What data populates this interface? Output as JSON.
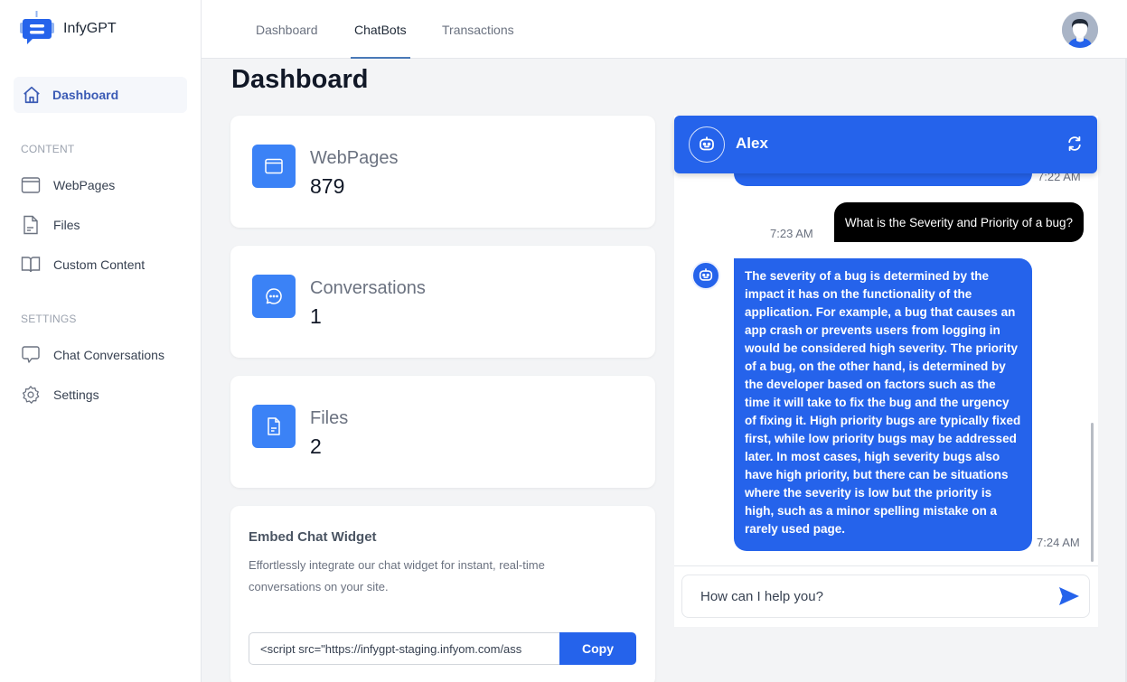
{
  "app": {
    "name": "InfyGPT"
  },
  "sidebar": {
    "active_item": {
      "label": "Dashboard",
      "icon": "home-icon"
    },
    "sections": [
      {
        "title": "CONTENT",
        "items": [
          {
            "label": "WebPages",
            "icon": "browser-window-icon"
          },
          {
            "label": "Files",
            "icon": "file-icon"
          },
          {
            "label": "Custom Content",
            "icon": "book-open-icon"
          }
        ]
      },
      {
        "title": "SETTINGS",
        "items": [
          {
            "label": "Chat Conversations",
            "icon": "chat-bubble-icon"
          },
          {
            "label": "Settings",
            "icon": "gear-icon"
          }
        ]
      }
    ]
  },
  "topbar": {
    "tabs": [
      {
        "label": "Dashboard",
        "active": false
      },
      {
        "label": "ChatBots",
        "active": true
      },
      {
        "label": "Transactions",
        "active": false
      }
    ],
    "avatar": "user-avatar"
  },
  "page": {
    "title": "Dashboard"
  },
  "stats": [
    {
      "label": "WebPages",
      "value": "879",
      "icon": "browser-window-icon"
    },
    {
      "label": "Conversations",
      "value": "1",
      "icon": "chat-dots-icon"
    },
    {
      "label": "Files",
      "value": "2",
      "icon": "file-icon"
    }
  ],
  "embed": {
    "title": "Embed Chat Widget",
    "description": "Effortlessly integrate our chat widget for instant, real-time conversations on your site.",
    "code_value": "<script src=\"https://infygpt-staging.infyom.com/ass",
    "copy_label": "Copy"
  },
  "chat": {
    "bot_name": "Alex",
    "accent": "#2563eb",
    "messages": [
      {
        "from": "bot",
        "text": "",
        "time": "7:22 AM"
      },
      {
        "from": "user",
        "text": "What is the Severity and Priority of a bug?",
        "time": "7:23 AM"
      },
      {
        "from": "bot",
        "text": "The severity of a bug is determined by the impact it has on the functionality of the application. For example, a bug that causes an app crash or prevents users from logging in would be considered high severity. The priority of a bug, on the other hand, is determined by the developer based on factors such as the time it will take to fix the bug and the urgency of fixing it. High priority bugs are typically fixed first, while low priority bugs may be addressed later. In most cases, high severity bugs also have high priority, but there can be situations where the severity is low but the priority is high, such as a minor spelling mistake on a rarely used page.",
        "time": "7:24 AM"
      }
    ],
    "input_placeholder": "How can I help you?"
  }
}
